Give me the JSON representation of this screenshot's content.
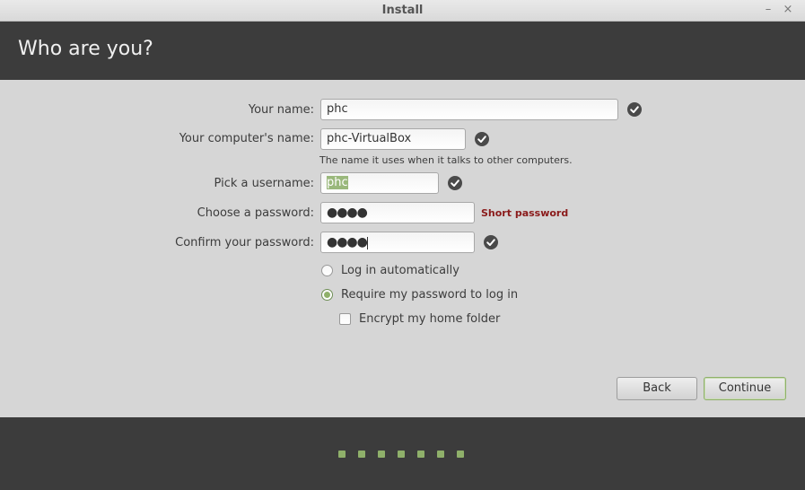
{
  "window": {
    "title": "Install",
    "minimize_glyph": "–",
    "close_glyph": "×"
  },
  "header": {
    "heading": "Who are you?"
  },
  "form": {
    "name_label": "Your name:",
    "name_value": "phc",
    "computer_label": "Your computer's name:",
    "computer_value": "phc-VirtualBox",
    "computer_hint": "The name it uses when it talks to other computers.",
    "username_label": "Pick a username:",
    "username_value": "phc",
    "password_label": "Choose a password:",
    "password_value": "●●●●",
    "password_warning": "Short password",
    "confirm_label": "Confirm your password:",
    "confirm_value": "●●●●"
  },
  "login_options": {
    "auto_label": "Log in automatically",
    "require_label": "Require my password to log in",
    "selected": "require",
    "encrypt_label": "Encrypt my home folder",
    "encrypt_checked": false
  },
  "buttons": {
    "back": "Back",
    "continue": "Continue"
  },
  "progress": {
    "total_steps": 7
  },
  "colors": {
    "accent": "#8fb06a",
    "header_bg": "#3c3c3c",
    "warning": "#8a1a1a"
  },
  "icons": {
    "valid": "check-circle-icon"
  }
}
